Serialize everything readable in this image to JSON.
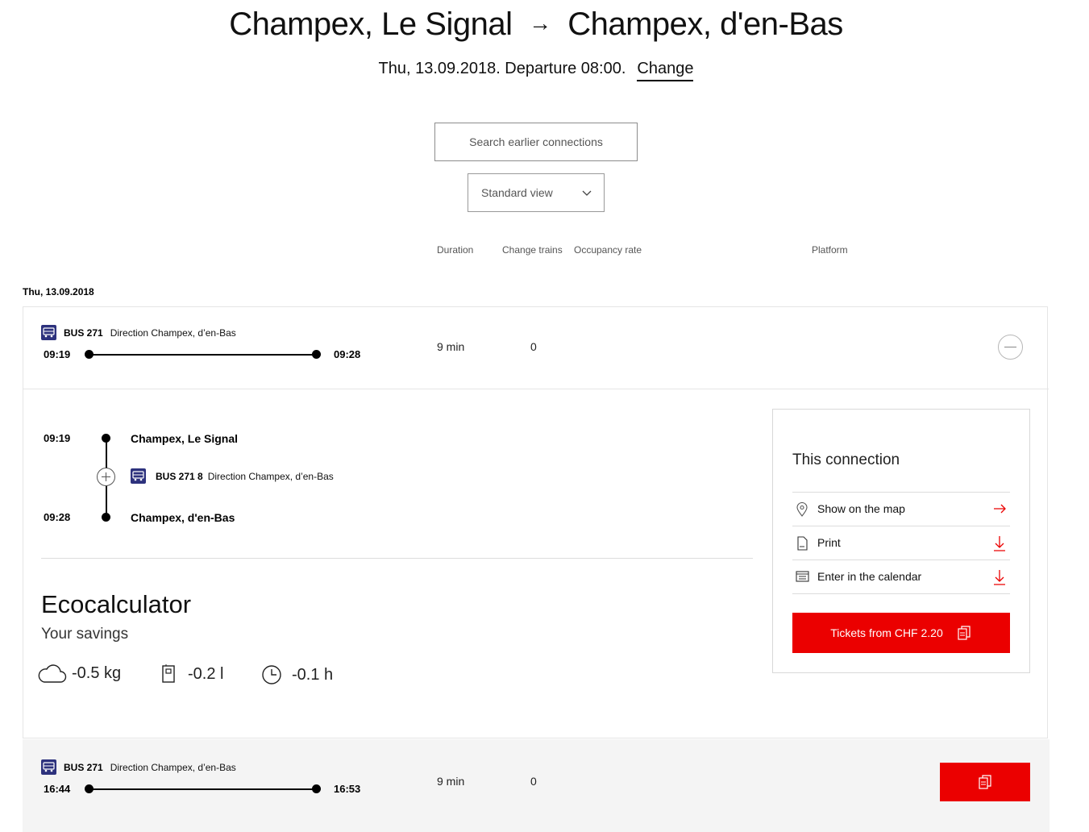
{
  "header": {
    "from": "Champex, Le Signal",
    "arrow": "→",
    "to": "Champex, d'en-Bas",
    "date_departure": "Thu, 13.09.2018. Departure 08:00.",
    "change_label": "Change"
  },
  "controls": {
    "earlier_label": "Search earlier connections",
    "view_selected": "Standard view"
  },
  "columns": {
    "duration": "Duration",
    "change_trains": "Change trains",
    "occupancy": "Occupancy rate",
    "platform": "Platform"
  },
  "date_group": "Thu, 13.09.2018",
  "connections": [
    {
      "line": "BUS 271",
      "direction": "Direction Champex, d’en-Bas",
      "dep": "09:19",
      "arr": "09:28",
      "duration": "9 min",
      "changes": "0",
      "expanded": true,
      "detail": {
        "dep_time": "09:19",
        "dep_stop": "Champex, Le Signal",
        "line": "BUS 271 8",
        "direction": "Direction Champex, d’en-Bas",
        "arr_time": "09:28",
        "arr_stop": "Champex, d'en-Bas"
      }
    },
    {
      "line": "BUS 271",
      "direction": "Direction Champex, d’en-Bas",
      "dep": "16:44",
      "arr": "16:53",
      "duration": "9 min",
      "changes": "0",
      "expanded": false
    }
  ],
  "eco": {
    "title": "Ecocalculator",
    "subtitle": "Your savings",
    "co2": "-0.5 kg",
    "fuel": "-0.2 l",
    "time": "-0.1 h"
  },
  "panel": {
    "title": "This connection",
    "actions": [
      {
        "label": "Show on the map",
        "icon": "map-pin-icon",
        "trail": "arrow-right-icon"
      },
      {
        "label": "Print",
        "icon": "document-icon",
        "trail": "download-icon"
      },
      {
        "label": "Enter in the calendar",
        "icon": "calendar-icon",
        "trail": "download-icon"
      }
    ],
    "tickets_label": "Tickets from CHF 2.20"
  },
  "colors": {
    "accent_red": "#eb0000",
    "bus_blue": "#2d327d"
  }
}
